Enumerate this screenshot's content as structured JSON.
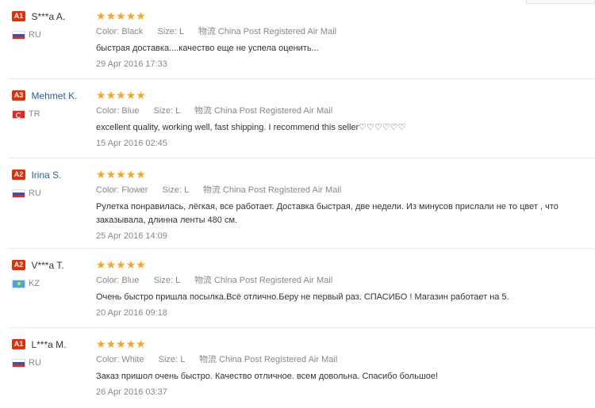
{
  "reviews": [
    {
      "level": "A1",
      "name": "S***a A.",
      "name_link": false,
      "country": "RU",
      "flag": "flag-ru",
      "stars": 5,
      "color_label": "Color:",
      "color_value": "Black",
      "size_label": "Size:",
      "size_value": "L",
      "shipping": "物流 China Post Registered Air Mail",
      "text": "быстрая доставка....качество еще не успела оценить...",
      "date": "29 Apr 2016 17:33"
    },
    {
      "level": "A3",
      "name": "Mehmet K.",
      "name_link": true,
      "country": "TR",
      "flag": "flag-tr",
      "stars": 5,
      "color_label": "Color:",
      "color_value": "Blue",
      "size_label": "Size:",
      "size_value": "L",
      "shipping": "物流 China Post Registered Air Mail",
      "text": "excellent quality, working well, fast shipping. I recommend this seller♡♡♡♡♡♡",
      "date": "15 Apr 2016 02:45"
    },
    {
      "level": "A2",
      "name": "Irina S.",
      "name_link": true,
      "country": "RU",
      "flag": "flag-ru",
      "stars": 5,
      "color_label": "Color:",
      "color_value": "Flower",
      "size_label": "Size:",
      "size_value": "L",
      "shipping": "物流 China Post Registered Air Mail",
      "text": "Рулетка понравилась, лёгкая, все работает. Доставка быстрая, две недели. Из минусов прислали не то цвет , что заказывала, длинна ленты 480 см.",
      "date": "25 Apr 2016 14:09"
    },
    {
      "level": "A2",
      "name": "V***a T.",
      "name_link": false,
      "country": "KZ",
      "flag": "flag-kz",
      "stars": 5,
      "color_label": "Color:",
      "color_value": "Blue",
      "size_label": "Size:",
      "size_value": "L",
      "shipping": "物流 China Post Registered Air Mail",
      "text": "Очень быстро пришла посылка.Всё отлично.Беру не первый раз. СПАСИБО ! Магазин работает на 5.",
      "date": "20 Apr 2016 09:18"
    },
    {
      "level": "A1",
      "name": "L***a M.",
      "name_link": false,
      "country": "RU",
      "flag": "flag-ru",
      "stars": 5,
      "color_label": "Color:",
      "color_value": "White",
      "size_label": "Size:",
      "size_value": "L",
      "shipping": "物流 China Post Registered Air Mail",
      "text": "Заказ пришол очень быстро. Качество отличное. всем довольна. Спасибо большое!",
      "date": "26 Apr 2016 03:37"
    }
  ],
  "colors": {
    "star": "#f5a623",
    "level_badge": "#e62e04",
    "name_link": "#2160a7"
  }
}
